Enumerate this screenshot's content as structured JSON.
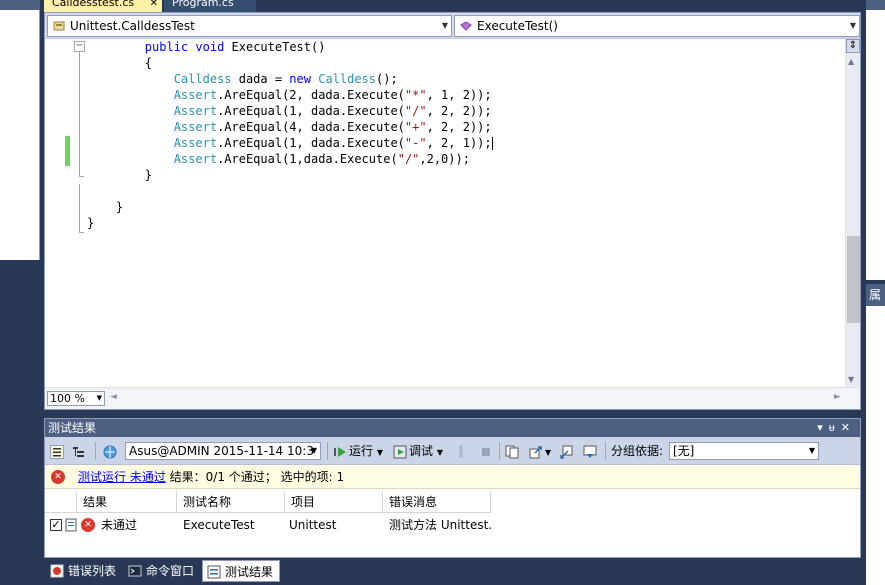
{
  "doc_tabs": [
    {
      "label": "Calldesstest.cs"
    },
    {
      "label": "Program.cs"
    }
  ],
  "nav": {
    "class_combo": "Unittest.CalldessTest",
    "member_combo": "ExecuteTest()"
  },
  "code": {
    "lines": [
      {
        "indent": "        ",
        "tokens": [
          {
            "k": "kw",
            "t": "public"
          },
          {
            "t": " "
          },
          {
            "k": "kw",
            "t": "void"
          },
          {
            "t": " ExecuteTest()"
          }
        ]
      },
      {
        "indent": "        ",
        "tokens": [
          {
            "t": "{"
          }
        ]
      },
      {
        "indent": "            ",
        "tokens": [
          {
            "k": "ty",
            "t": "Calldess"
          },
          {
            "t": " dada = "
          },
          {
            "k": "kw",
            "t": "new"
          },
          {
            "t": " "
          },
          {
            "k": "ty",
            "t": "Calldess"
          },
          {
            "t": "();"
          }
        ]
      },
      {
        "indent": "            ",
        "tokens": [
          {
            "k": "ty",
            "t": "Assert"
          },
          {
            "t": ".AreEqual(2, dada.Execute("
          },
          {
            "k": "str",
            "t": "\"*\""
          },
          {
            "t": ", 1, 2));"
          }
        ]
      },
      {
        "indent": "            ",
        "tokens": [
          {
            "k": "ty",
            "t": "Assert"
          },
          {
            "t": ".AreEqual(1, dada.Execute("
          },
          {
            "k": "str",
            "t": "\"/\""
          },
          {
            "t": ", 2, 2));"
          }
        ]
      },
      {
        "indent": "            ",
        "tokens": [
          {
            "k": "ty",
            "t": "Assert"
          },
          {
            "t": ".AreEqual(4, dada.Execute("
          },
          {
            "k": "str",
            "t": "\"+\""
          },
          {
            "t": ", 2, 2));"
          }
        ]
      },
      {
        "indent": "            ",
        "tokens": [
          {
            "k": "ty",
            "t": "Assert"
          },
          {
            "t": ".AreEqual(1, dada.Execute("
          },
          {
            "k": "str",
            "t": "\"-\""
          },
          {
            "t": ", 2, 1));"
          }
        ],
        "caret": true
      },
      {
        "indent": "            ",
        "tokens": [
          {
            "k": "ty",
            "t": "Assert"
          },
          {
            "t": ".AreEqual(1,dada.Execute("
          },
          {
            "k": "str",
            "t": "\"/\""
          },
          {
            "t": ",2,0));"
          }
        ]
      },
      {
        "indent": "        ",
        "tokens": [
          {
            "t": "}"
          }
        ]
      },
      {
        "indent": "",
        "tokens": [
          {
            "t": ""
          }
        ]
      },
      {
        "indent": "    ",
        "tokens": [
          {
            "t": "}"
          }
        ]
      },
      {
        "indent": "",
        "tokens": [
          {
            "t": "}"
          }
        ]
      }
    ]
  },
  "zoom": "100 %",
  "test_results": {
    "title": "测试结果",
    "toolbar": {
      "run_config": "Asus@ADMIN 2015-11-14 10:3",
      "run_label": "运行",
      "debug_label": "调试",
      "group_by_label": "分组依据:",
      "group_by_value": "[无]"
    },
    "status": {
      "link": "测试运行 未通过",
      "text": " 结果：0/1 个通过；  选中的项: 1"
    },
    "columns": [
      "结果",
      "测试名称",
      "项目",
      "错误消息"
    ],
    "rows": [
      {
        "result": "未通过",
        "name": "ExecuteTest",
        "project": "Unittest",
        "error": "测试方法 Unittest.C"
      }
    ]
  },
  "bottom_tabs": [
    "错误列表",
    "命令窗口",
    "测试结果"
  ],
  "right_panel": {
    "header": "属性"
  },
  "colors": {
    "chrome": "#293955",
    "tab_active": "#fff1a8",
    "title_bar": "#4d6082",
    "toolbar": "#ccd5e8",
    "keyword": "#0000ff",
    "type": "#2b91af",
    "string": "#a31515",
    "change_marker": "#6fd160",
    "error": "#d93a2b"
  }
}
